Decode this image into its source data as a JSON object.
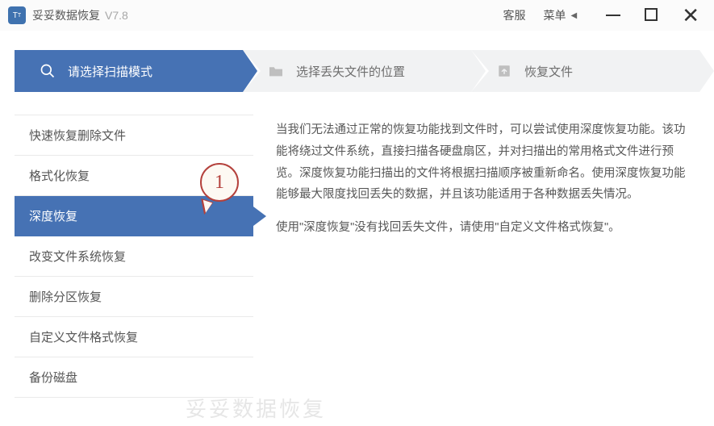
{
  "header": {
    "app_title": "妥妥数据恢复",
    "app_version": "V7.8",
    "links": {
      "service": "客服",
      "menu": "菜单"
    }
  },
  "steps": [
    {
      "label": "请选择扫描模式",
      "icon": "search"
    },
    {
      "label": "选择丢失文件的位置",
      "icon": "folder"
    },
    {
      "label": "恢复文件",
      "icon": "restore"
    }
  ],
  "active_step_index": 0,
  "sidebar": {
    "items": [
      {
        "label": "快速恢复删除文件"
      },
      {
        "label": "格式化恢复"
      },
      {
        "label": "深度恢复"
      },
      {
        "label": "改变文件系统恢复"
      },
      {
        "label": "删除分区恢复"
      },
      {
        "label": "自定义文件格式恢复"
      },
      {
        "label": "备份磁盘"
      }
    ],
    "selected_index": 2
  },
  "content": {
    "p1": "当我们无法通过正常的恢复功能找到文件时，可以尝试使用深度恢复功能。该功能将绕过文件系统，直接扫描各硬盘扇区，并对扫描出的常用格式文件进行预览。深度恢复功能扫描出的文件将根据扫描顺序被重新命名。使用深度恢复功能能够最大限度找回丢失的数据，并且该功能适用于各种数据丢失情况。",
    "p2": "使用\"深度恢复\"没有找回丢失文件，请使用\"自定义文件格式恢复\"。"
  },
  "annotation": {
    "number": "1"
  },
  "watermark": "妥妥数据恢复"
}
